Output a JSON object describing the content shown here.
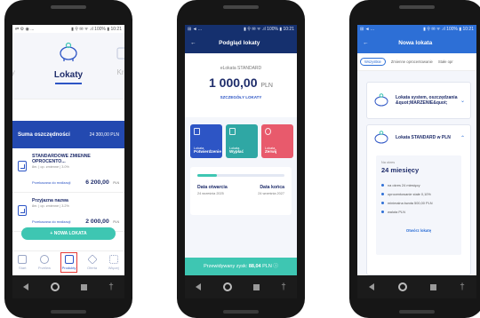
{
  "phone1": {
    "status": {
      "left": "⇄ ⚙ ◉ ...",
      "right": "▮ ⚲ ✉ ᯤ .ıl 100% ▮ 10:21"
    },
    "side_left": "rty",
    "side_right": "Krec",
    "title": "Lokaty",
    "summary": {
      "label": "Suma oszczędności",
      "value": "24 300,00",
      "currency": "PLN"
    },
    "deposits": [
      {
        "name": "STANDARDOWE ZMIENNE OPROCENTO...",
        "details": "8m. | op. zmienne | 3.0%",
        "link": "Przekazana do realizacji",
        "amount": "6 200,00",
        "currency": "PLN"
      },
      {
        "name": "Przyjazna nazwa",
        "details": "8m. | op. zmienne | 3.2%",
        "link": "Przekazana do realizacji",
        "amount": "2 000,00",
        "currency": "PLN"
      }
    ],
    "new_button": "+ NOWA LOKATA",
    "tabs": [
      {
        "label": "Start",
        "icon": "home-icon"
      },
      {
        "label": "Przelew",
        "icon": "transfer-icon"
      },
      {
        "label": "Produkty",
        "icon": "wallet-icon"
      },
      {
        "label": "Oferta",
        "icon": "tag-icon"
      },
      {
        "label": "Więcej",
        "icon": "grid-icon"
      }
    ]
  },
  "phone2": {
    "status": {
      "left": "⊞ ◄ ...",
      "right": "▮ ⚲ ✉ ᯤ .ıl 100% ▮ 10:21"
    },
    "title": "Podgląd lokaty",
    "product_name": "eLokata STANDARD",
    "amount": "1 000,00",
    "currency": "PLN",
    "details_link": "SZCZEGÓŁY LOKATY",
    "cards": [
      {
        "line1": "Lokata",
        "line2": "Potwierdzenie",
        "icon": "document-icon"
      },
      {
        "line1": "Lokata",
        "line2": "Wypłać",
        "icon": "withdraw-icon"
      },
      {
        "line1": "Lokata",
        "line2": "Zerwij",
        "icon": "cancel-circle-icon"
      }
    ],
    "progress": 0.22,
    "open_label": "Data otwarcia",
    "open_date": "24 września 2025",
    "end_label": "Data końca",
    "end_date": "24 września 2027",
    "profit_label": "Przewidywany zysk:",
    "profit_value": "88,04",
    "profit_currency": "PLN"
  },
  "phone3": {
    "status": {
      "left": "⊞ ◄ ...",
      "right": "▮ ⚲ ✉ ᯤ .ıl 100% ▮ 10:21"
    },
    "title": "Nowa lokata",
    "filters": [
      "Wszystkie",
      "Zmienne oprocentowanie",
      "Stałe opr"
    ],
    "acc1_title": "Lokata system, oszczędzania &quot;MARZENIE&quot;",
    "acc2_title": "Lokata STANDARD w PLN",
    "period_label": "Na okres",
    "period_value": "24 miesięcy",
    "features": [
      "na okres 24 miesięcy",
      "oprocentowanie stałe 0,10%",
      "minimalna kwota 500,00 PLN",
      "waluta PLN"
    ],
    "open_link": "Otwórz lokatę"
  },
  "colors": {
    "navy": "#1f2d6b",
    "blue": "#2d55c5",
    "teal": "#3ec6b2",
    "red": "#e85a6c"
  }
}
